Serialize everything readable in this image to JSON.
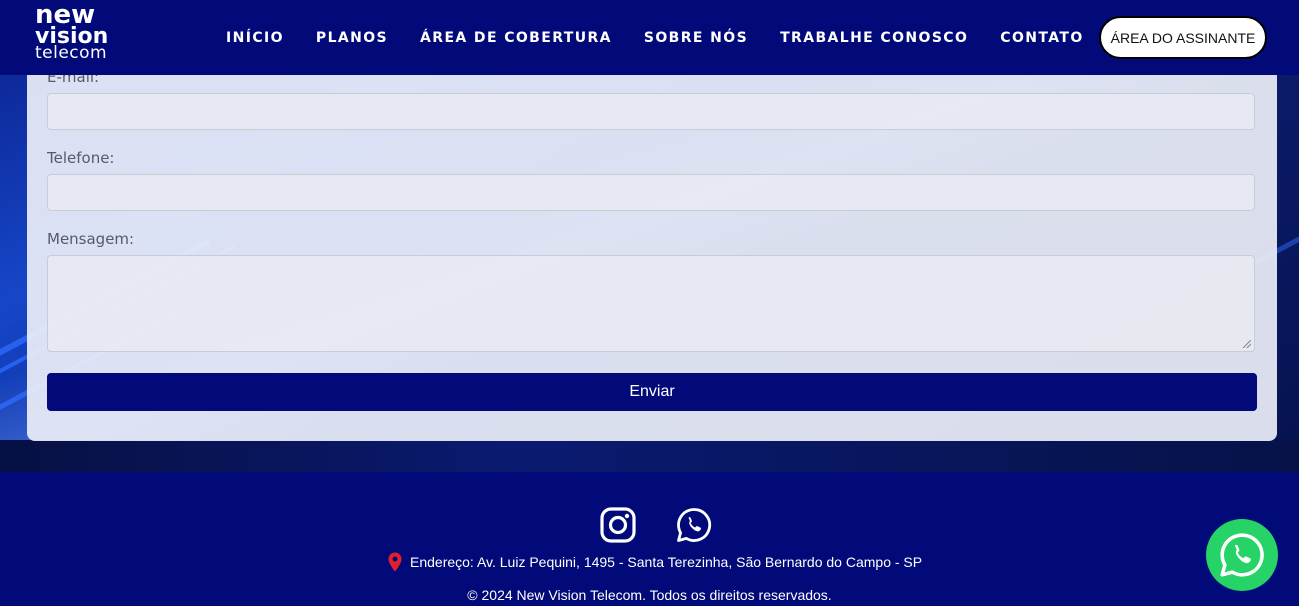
{
  "header": {
    "logo": {
      "line1": "new",
      "line2": "vision",
      "line3": "telecom"
    },
    "nav": [
      {
        "label": "INÍCIO"
      },
      {
        "label": "PLANOS"
      },
      {
        "label": "ÁREA DE COBERTURA"
      },
      {
        "label": "SOBRE NÓS"
      },
      {
        "label": "TRABALHE CONOSCO"
      },
      {
        "label": "CONTATO"
      }
    ],
    "subscriber_button": "ÁREA DO ASSINANTE"
  },
  "form": {
    "email_label": "E-mail:",
    "email_value": "",
    "phone_label": "Telefone:",
    "phone_value": "",
    "message_label": "Mensagem:",
    "message_value": "",
    "submit_label": "Enviar"
  },
  "footer": {
    "social_icons": [
      "instagram-icon",
      "whatsapp-icon"
    ],
    "address": "Endereço: Av. Luiz Pequini, 1495 - Santa Terezinha, São Bernardo do Campo - SP",
    "copyright": "© 2024 New Vision Telecom. Todos os direitos reservados."
  },
  "floating": {
    "icon": "whatsapp-icon",
    "color": "#25d366"
  },
  "colors": {
    "brand": "#020a7a",
    "accent": "#25d366"
  }
}
